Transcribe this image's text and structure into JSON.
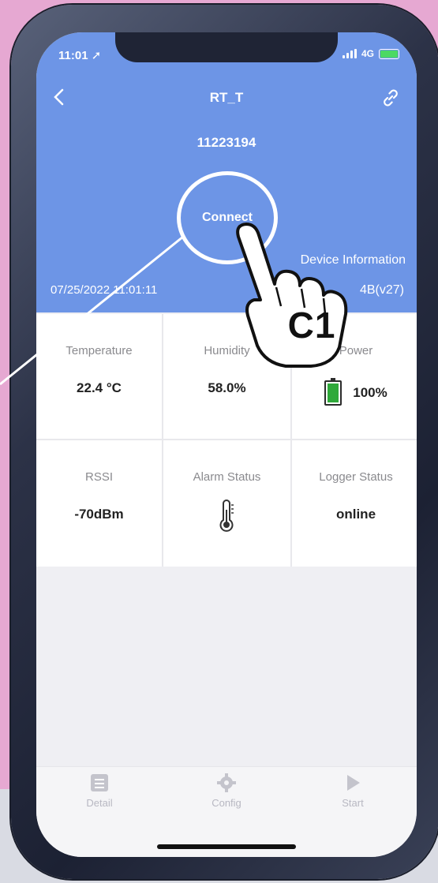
{
  "status_bar": {
    "time": "11:01",
    "network": "4G"
  },
  "header": {
    "title": "RT_T",
    "device_id": "11223194",
    "connect_label": "Connect",
    "device_info_label": "Device Information",
    "datetime": "07/25/2022 11:01:11",
    "firmware": "4B(v27)"
  },
  "cells": [
    {
      "label": "Temperature",
      "value": "22.4 °C"
    },
    {
      "label": "Humidity",
      "value": "58.0%"
    },
    {
      "label": "Power",
      "value": "100%"
    },
    {
      "label": "RSSI",
      "value": "-70dBm"
    },
    {
      "label": "Alarm Status",
      "value": ""
    },
    {
      "label": "Logger Status",
      "value": "online"
    }
  ],
  "tabs": [
    {
      "label": "Detail",
      "icon": "list-icon"
    },
    {
      "label": "Config",
      "icon": "gear-icon"
    },
    {
      "label": "Start",
      "icon": "play-icon"
    }
  ],
  "annotation": {
    "callout": "C1"
  },
  "colors": {
    "header": "#6d95e6",
    "battery_fill": "#2fa93a",
    "background": "#e6a8d2"
  }
}
